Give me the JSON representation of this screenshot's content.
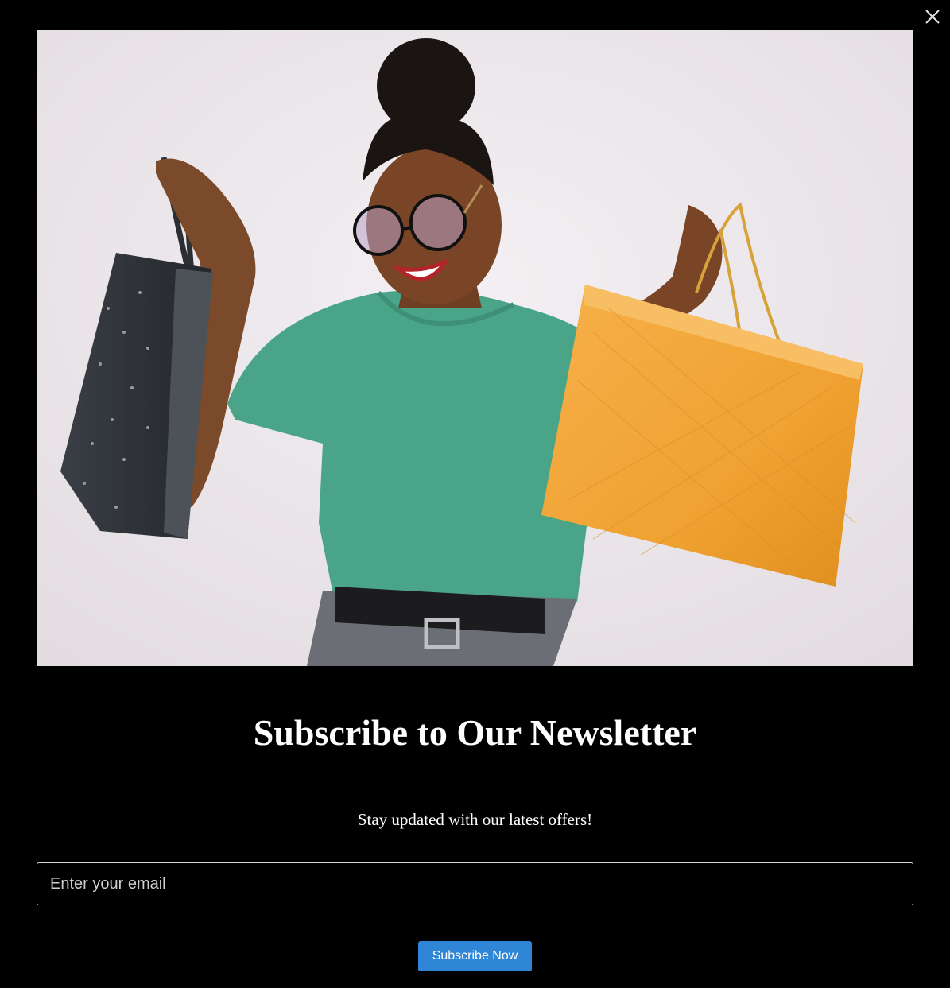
{
  "modal": {
    "close_icon": "close-icon",
    "title": "Subscribe to Our Newsletter",
    "subtitle": "Stay updated with our latest offers!",
    "email_placeholder": "Enter your email",
    "email_value": "",
    "subscribe_label": "Subscribe Now"
  },
  "colors": {
    "background": "#000000",
    "button": "#2f86d6",
    "text": "#ffffff",
    "input_border": "#d8d8d8"
  }
}
